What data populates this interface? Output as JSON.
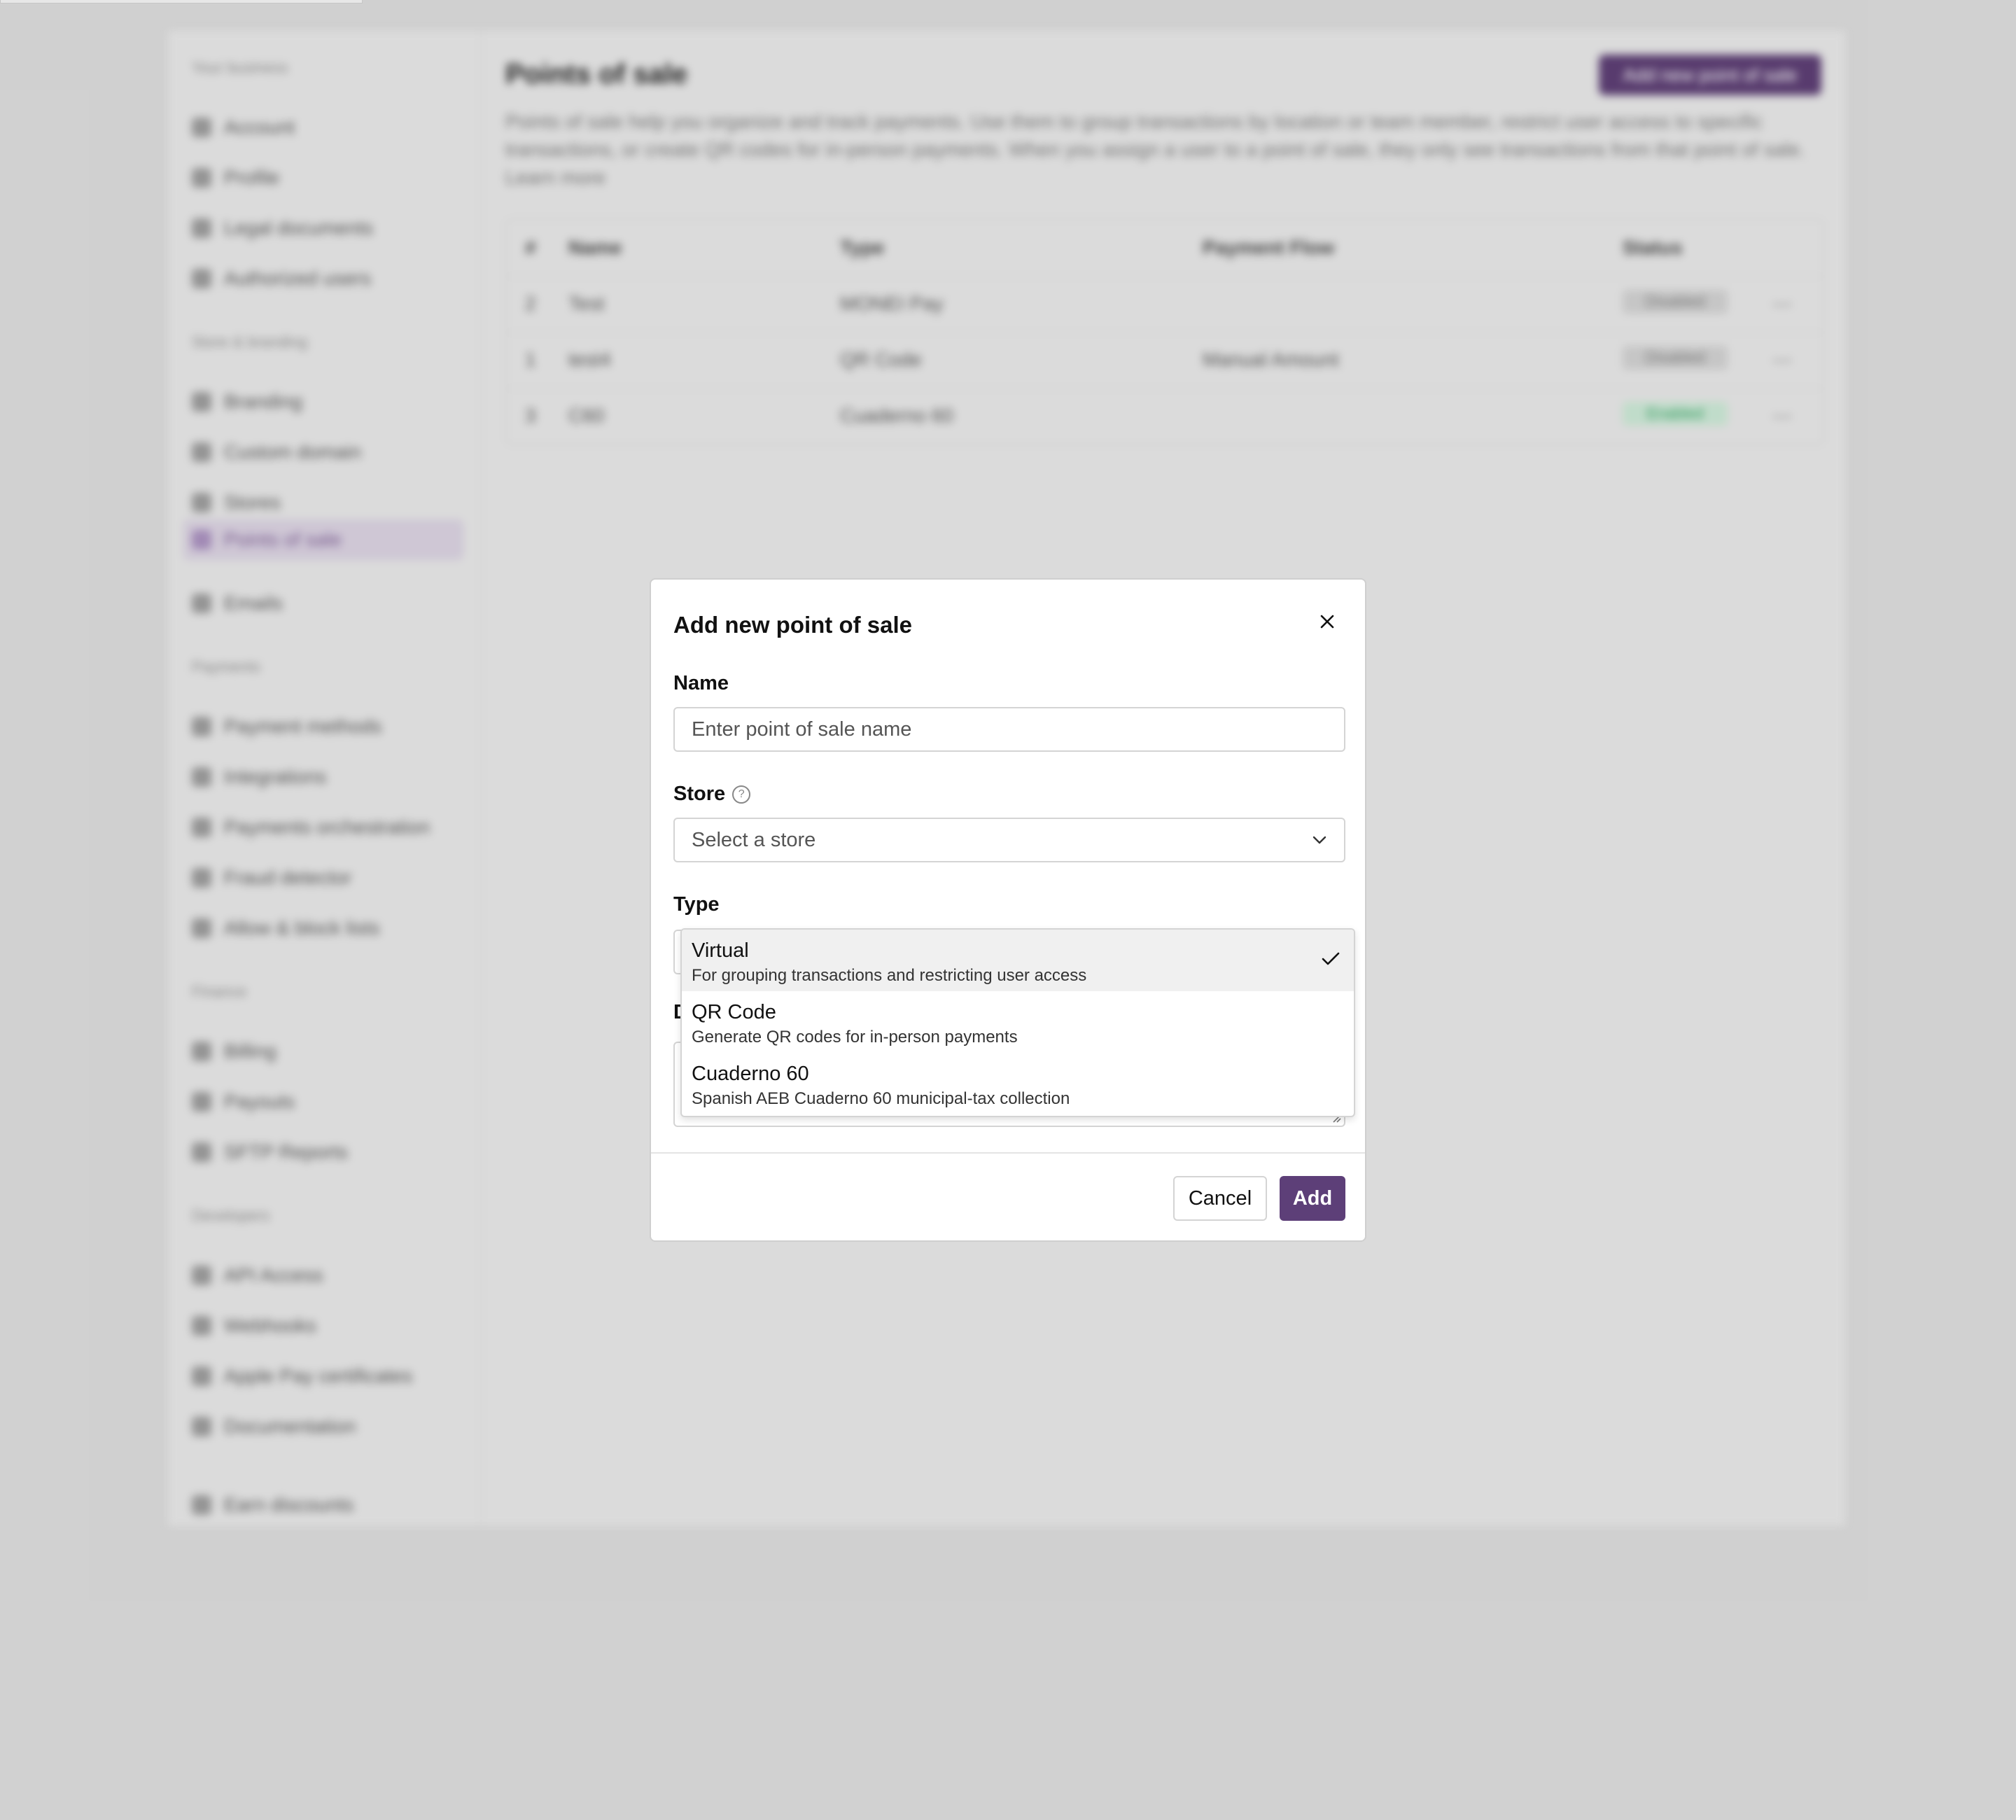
{
  "sidebar": {
    "sections": [
      {
        "title": "Your business",
        "items": [
          "Account",
          "Profile",
          "Legal documents",
          "Authorized users"
        ]
      },
      {
        "title": "Store & branding",
        "items": [
          "Branding",
          "Custom domain",
          "Stores",
          "Points of sale",
          "Emails"
        ]
      },
      {
        "title": "Payments",
        "items": [
          "Payment methods",
          "Integrations",
          "Payments orchestration",
          "Fraud detector",
          "Allow & block lists"
        ]
      },
      {
        "title": "Finance",
        "items": [
          "Billing",
          "Payouts",
          "SFTP Reports"
        ]
      },
      {
        "title": "Developers",
        "items": [
          "API Access",
          "Webhooks",
          "Apple Pay certificates",
          "Documentation"
        ]
      }
    ],
    "footer_item": "Earn discounts"
  },
  "page": {
    "title": "Points of sale",
    "add_button": "Add new point of sale",
    "description": "Points of sale help you organize and track payments. Use them to group transactions by location or team member, restrict user access to specific transactions, or create QR codes for in-person payments. When you assign a user to a point of sale, they only see transactions from that point of sale. Learn more"
  },
  "table": {
    "headers": [
      "#",
      "Name",
      "Type",
      "Payment Flow",
      "Status"
    ],
    "rows": [
      {
        "id": "2",
        "name": "Test",
        "type": "MONEI Pay",
        "flow": "",
        "status": "Disabled"
      },
      {
        "id": "1",
        "name": "test4",
        "type": "QR Code",
        "flow": "Manual Amount",
        "status": "Disabled"
      },
      {
        "id": "3",
        "name": "C60",
        "type": "Cuaderno 60",
        "flow": "",
        "status": "Enabled"
      }
    ]
  },
  "modal": {
    "title": "Add new point of sale",
    "name_label": "Name",
    "name_placeholder": "Enter point of sale name",
    "store_label": "Store",
    "store_help": "?",
    "store_placeholder": "Select a store",
    "type_label": "Type",
    "description_label_partial": "D",
    "cancel": "Cancel",
    "add": "Add"
  },
  "type_options": [
    {
      "label": "Virtual",
      "description": "For grouping transactions and restricting user access",
      "selected": true
    },
    {
      "label": "QR Code",
      "description": "Generate QR codes for in-person payments",
      "selected": false
    },
    {
      "label": "Cuaderno 60",
      "description": "Spanish AEB Cuaderno 60 municipal-tax collection",
      "selected": false
    }
  ],
  "colors": {
    "accent": "#5d3f78",
    "enabled_badge": "#2e9d5e"
  }
}
